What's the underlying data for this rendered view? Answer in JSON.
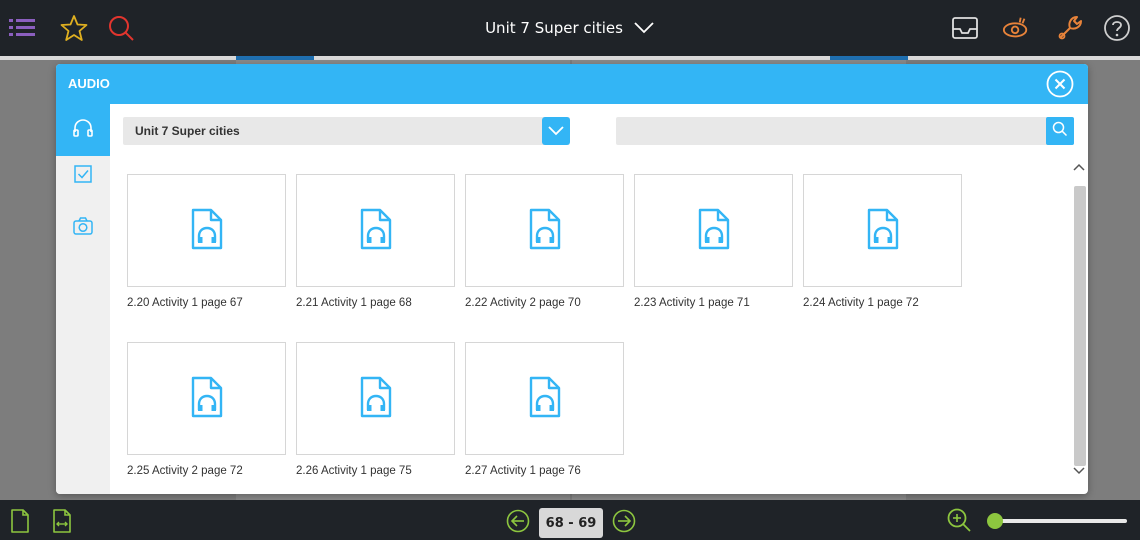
{
  "header": {
    "title": "Unit 7 Super cities"
  },
  "dialog": {
    "title": "AUDIO",
    "folder": {
      "selected": "Unit 7 Super cities"
    },
    "search": {
      "placeholder": "",
      "value": ""
    },
    "tabs": [
      {
        "name": "audio",
        "icon": "headphones-icon",
        "active": true
      },
      {
        "name": "checklist",
        "icon": "checkbox-icon",
        "active": false
      },
      {
        "name": "photo",
        "icon": "camera-icon",
        "active": false
      }
    ],
    "items": [
      {
        "label": "2.20 Activity 1 page 67",
        "icon": "audio-file-icon"
      },
      {
        "label": "2.21 Activity 1 page 68",
        "icon": "audio-file-icon"
      },
      {
        "label": "2.22 Activity 2 page 70",
        "icon": "audio-file-icon"
      },
      {
        "label": "2.23 Activity 1 page 71",
        "icon": "audio-file-icon"
      },
      {
        "label": "2.24 Activity 1 page 72",
        "icon": "audio-file-icon"
      },
      {
        "label": "2.25 Activity 2 page 72",
        "icon": "audio-file-icon"
      },
      {
        "label": "2.26 Activity 1 page 75",
        "icon": "audio-file-icon"
      },
      {
        "label": "2.27 Activity 1 page 76",
        "icon": "audio-file-icon"
      }
    ]
  },
  "footer": {
    "pages": "68 - 69",
    "zoom_level": 0.0
  },
  "colors": {
    "accent": "#33b5f5",
    "bar": "#1f2328",
    "green": "#8dc63f",
    "orange": "#e8833a",
    "red": "#e2352e",
    "purple": "#8b5fbf"
  }
}
